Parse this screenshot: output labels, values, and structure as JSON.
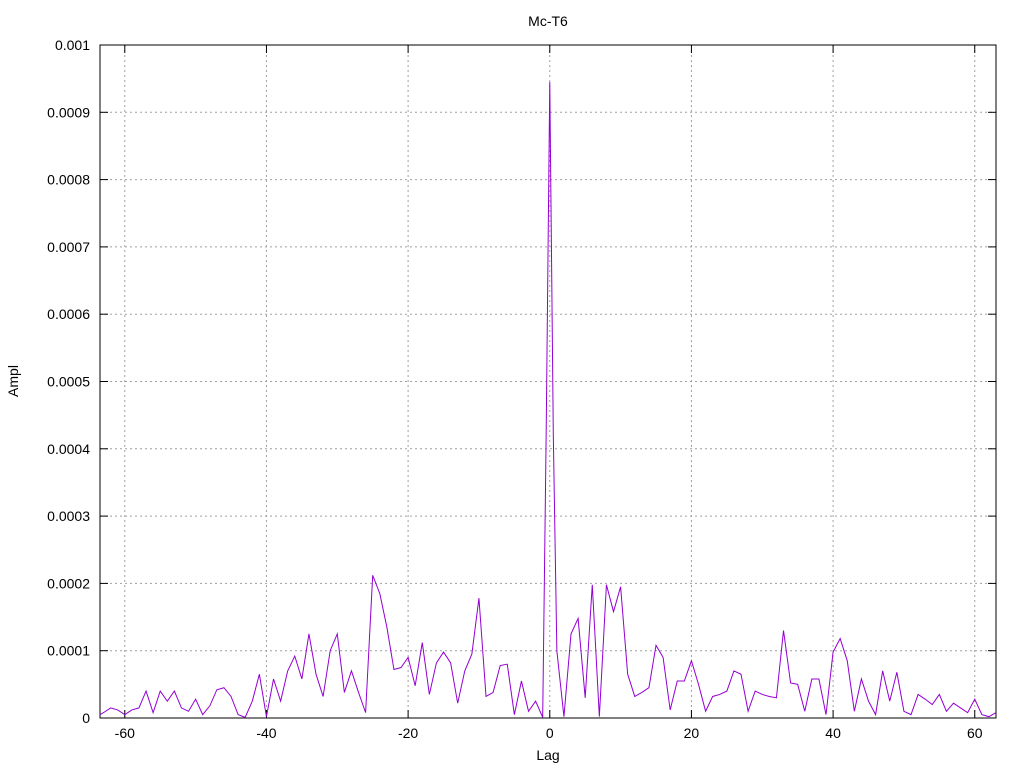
{
  "chart_data": {
    "type": "line",
    "title": "Mc-T6",
    "xlabel": "Lag",
    "ylabel": "Ampl",
    "xlim": [
      -63.5,
      63
    ],
    "ylim": [
      0,
      0.001
    ],
    "grid": true,
    "xticks": [
      -60,
      -40,
      -20,
      0,
      20,
      40,
      60
    ],
    "xtick_labels": [
      "-60",
      "-40",
      "-20",
      "0",
      "20",
      "40",
      "60"
    ],
    "yticks": [
      0,
      0.0001,
      0.0002,
      0.0003,
      0.0004,
      0.0005,
      0.0006,
      0.0007,
      0.0008,
      0.0009,
      0.001
    ],
    "ytick_labels": [
      "0",
      "0.0001",
      "0.0002",
      "0.0003",
      "0.0004",
      "0.0005",
      "0.0006",
      "0.0007",
      "0.0008",
      "0.0009",
      "0.001"
    ],
    "series": [
      {
        "color": "#9400d3",
        "points": [
          [
            -63.5,
            5e-06
          ],
          [
            -63,
            8e-06
          ],
          [
            -62,
            1.5e-05
          ],
          [
            -61,
            1.2e-05
          ],
          [
            -60,
            5e-06
          ],
          [
            -59,
            1.2e-05
          ],
          [
            -58,
            1.5e-05
          ],
          [
            -57,
            4e-05
          ],
          [
            -56,
            8e-06
          ],
          [
            -55,
            4e-05
          ],
          [
            -54,
            2.5e-05
          ],
          [
            -53,
            4e-05
          ],
          [
            -52,
            1.5e-05
          ],
          [
            -51,
            1e-05
          ],
          [
            -50,
            2.8e-05
          ],
          [
            -49,
            5e-06
          ],
          [
            -48,
            1.8e-05
          ],
          [
            -47,
            4.2e-05
          ],
          [
            -46,
            4.5e-05
          ],
          [
            -45,
            3.2e-05
          ],
          [
            -44,
            5e-06
          ],
          [
            -43,
            1e-06
          ],
          [
            -42,
            2.5e-05
          ],
          [
            -41,
            6.5e-05
          ],
          [
            -40,
            2e-06
          ],
          [
            -39,
            5.8e-05
          ],
          [
            -38,
            2.5e-05
          ],
          [
            -37,
            7e-05
          ],
          [
            -36,
            9.2e-05
          ],
          [
            -35,
            5.8e-05
          ],
          [
            -34,
            0.000125
          ],
          [
            -33,
            6.5e-05
          ],
          [
            -32,
            3.2e-05
          ],
          [
            -31,
            0.0001
          ],
          [
            -30,
            0.000125
          ],
          [
            -29,
            3.8e-05
          ],
          [
            -28,
            7e-05
          ],
          [
            -27,
            3.8e-05
          ],
          [
            -26,
            8e-06
          ],
          [
            -25,
            0.000212
          ],
          [
            -24,
            0.000185
          ],
          [
            -23,
            0.000135
          ],
          [
            -22,
            7.2e-05
          ],
          [
            -21,
            7.5e-05
          ],
          [
            -20,
            9e-05
          ],
          [
            -19,
            4.8e-05
          ],
          [
            -18,
            0.000112
          ],
          [
            -17,
            3.5e-05
          ],
          [
            -16,
            8.2e-05
          ],
          [
            -15,
            9.8e-05
          ],
          [
            -14,
            8.2e-05
          ],
          [
            -13,
            2.2e-05
          ],
          [
            -12,
            7e-05
          ],
          [
            -11,
            9.5e-05
          ],
          [
            -10,
            0.000178
          ],
          [
            -9,
            3.2e-05
          ],
          [
            -8,
            3.8e-05
          ],
          [
            -7,
            7.8e-05
          ],
          [
            -6,
            8e-05
          ],
          [
            -5,
            5e-06
          ],
          [
            -4,
            5.5e-05
          ],
          [
            -3,
            1e-05
          ],
          [
            -2,
            2.5e-05
          ],
          [
            -1,
            1e-06
          ],
          [
            -0.5,
            0.00043
          ],
          [
            0,
            0.000945
          ],
          [
            0.5,
            0.00042
          ],
          [
            1,
            0.0001
          ],
          [
            2,
            2e-06
          ],
          [
            3,
            0.000125
          ],
          [
            4,
            0.000148
          ],
          [
            5,
            3e-05
          ],
          [
            6,
            0.000198
          ],
          [
            7,
            2e-06
          ],
          [
            8,
            0.000198
          ],
          [
            9,
            0.000158
          ],
          [
            10,
            0.000195
          ],
          [
            11,
            6.5e-05
          ],
          [
            12,
            3.2e-05
          ],
          [
            13,
            3.8e-05
          ],
          [
            14,
            4.5e-05
          ],
          [
            15,
            0.000108
          ],
          [
            16,
            9e-05
          ],
          [
            17,
            1.2e-05
          ],
          [
            18,
            5.5e-05
          ],
          [
            19,
            5.5e-05
          ],
          [
            20,
            8.5e-05
          ],
          [
            21,
            5e-05
          ],
          [
            22,
            1e-05
          ],
          [
            23,
            3.2e-05
          ],
          [
            24,
            3.5e-05
          ],
          [
            25,
            4e-05
          ],
          [
            26,
            7e-05
          ],
          [
            27,
            6.5e-05
          ],
          [
            28,
            1e-05
          ],
          [
            29,
            4e-05
          ],
          [
            30,
            3.5e-05
          ],
          [
            31,
            3.2e-05
          ],
          [
            32,
            3e-05
          ],
          [
            33,
            0.00013
          ],
          [
            34,
            5.2e-05
          ],
          [
            35,
            5e-05
          ],
          [
            36,
            1e-05
          ],
          [
            37,
            5.8e-05
          ],
          [
            38,
            5.8e-05
          ],
          [
            39,
            5e-06
          ],
          [
            40,
            9.8e-05
          ],
          [
            41,
            0.000118
          ],
          [
            42,
            8.5e-05
          ],
          [
            43,
            1e-05
          ],
          [
            44,
            5.8e-05
          ],
          [
            45,
            2.5e-05
          ],
          [
            46,
            5e-06
          ],
          [
            47,
            7e-05
          ],
          [
            48,
            2.5e-05
          ],
          [
            49,
            6.8e-05
          ],
          [
            50,
            1e-05
          ],
          [
            51,
            5e-06
          ],
          [
            52,
            3.5e-05
          ],
          [
            53,
            2.8e-05
          ],
          [
            54,
            2e-05
          ],
          [
            55,
            3.5e-05
          ],
          [
            56,
            1e-05
          ],
          [
            57,
            2.2e-05
          ],
          [
            58,
            1.5e-05
          ],
          [
            59,
            8e-06
          ],
          [
            60,
            2.8e-05
          ],
          [
            61,
            5e-06
          ],
          [
            62,
            2e-06
          ],
          [
            63,
            8e-06
          ]
        ]
      }
    ]
  }
}
